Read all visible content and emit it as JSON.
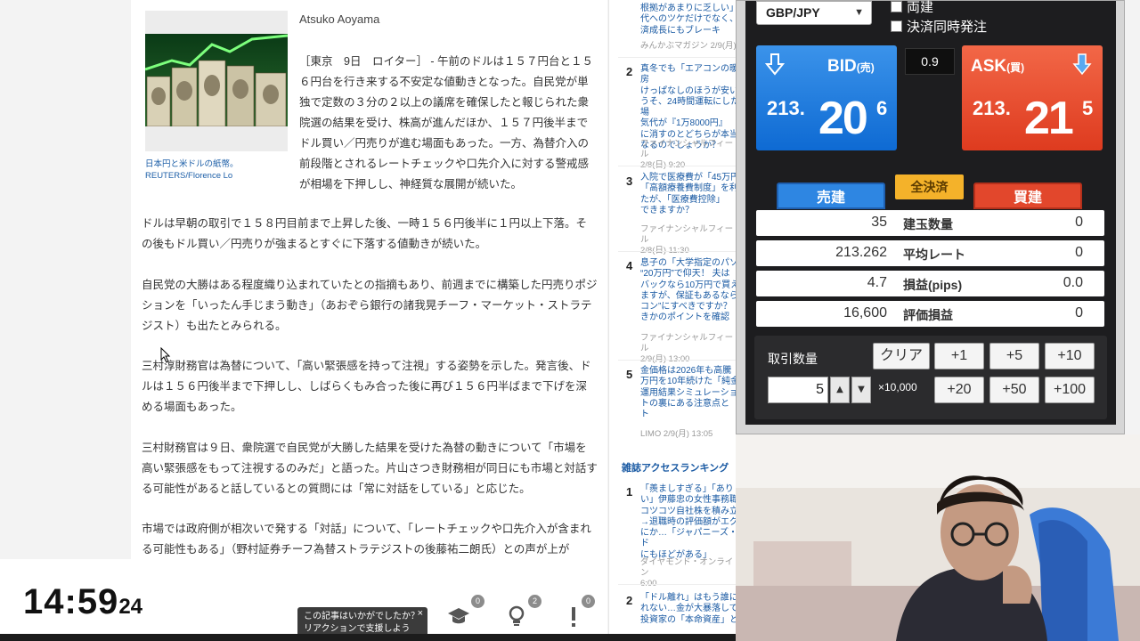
{
  "article": {
    "author": "Atsuko Aoyama",
    "caption": "日本円と米ドルの紙幣。\nREUTERS/Florence Lo",
    "lead": "［東京　9日　ロイター］ - 午前のドルは１５７円台と１５６円台を行き来する不安定な値動きとなった。自民党が単独で定数の３分の２以上の議席を確保したと報じられた衆院選の結果を受け、株高が進んだほか、１５７円後半までドル買い／円売りが進む場面もあった。一方、為替介入の前段階とされるレートチェックや口先介入に対する警戒感が相場を下押しし、神経質な展開が続いた。",
    "paragraphs": [
      "ドルは早朝の取引で１５８円目前まで上昇した後、一時１５６円後半に１円以上下落。その後もドル買い／円売りが強まるとすぐに下落する値動きが続いた。",
      "自民党の大勝はある程度織り込まれていたとの指摘もあり、前週までに構築した円売りポジションを「いったん手じまう動き」（あおぞら銀行の諸我晃チーフ・マーケット・ストラテジスト）も出たとみられる。",
      "三村淳財務官は為替について、「高い緊張感を持って注視」する姿勢を示した。発言後、ドルは１５６円後半まで下押しし、しばらくもみ合った後に再び１５６円半ばまで下げを深める場面もあった。",
      "三村財務官は９日、衆院選で自民党が大勝した結果を受けた為替の動きについて「市場を高い緊張感をもって注視するのみだ」と語った。片山さつき財務相が同日にも市場と対話する可能性があると話しているとの質問には「常に対話をしている」と応じた。",
      "市場では政府側が相次いで発する「対話」について、「レートチェックや口先介入が含まれる可能性もある」（野村証券チーフ為替ストラテジストの後藤祐二朗氏）との声が上が"
    ]
  },
  "sidebar": {
    "top_item": {
      "title": "根拠があまりに乏しい」\n代へのツケだけでなく、\n済成長にもブレーキ",
      "meta": "みんかぶマガジン 2/9(月)"
    },
    "items": [
      {
        "rank": "2",
        "title": "真冬でも「エアコンの暖房\nけっぱなしのほうが安い\nうそ、24時間運転にした場\n気代が『1万8000円』\nに消すのとどちらが本当\nなるのでしょうか？",
        "meta": "ファイナンシャルフィール\n2/8(日) 9:20"
      },
      {
        "rank": "3",
        "title": "入院で医療費が「45万円\n「高額療養費制度」を利\nたが、「医療費控除」\nできますか？",
        "meta": "ファイナンシャルフィール\n2/8(日) 11:30"
      },
      {
        "rank": "4",
        "title": "息子の「大学指定のパソ\n“20万円”で仰天！ 夫は\nバックなら10万円で買え\nますが、保証もあるなら\nコン”にすべきですか？\nきかのポイントを確認",
        "meta": "ファイナンシャルフィール\n2/9(月) 13:00"
      },
      {
        "rank": "5",
        "title": "金価格は2026年も高騰\n万円を10年続けた「純金\n運用結果シミュレーショ\nトの裏にある注意点と\nト",
        "meta": "LIMO 2/9(月) 13:05"
      }
    ],
    "access_heading": "雑誌アクセスランキング",
    "access_items": [
      {
        "rank": "1",
        "title": "「羨ましすぎる」「あり\nい」伊藤忠の女性事務職\nコツコツ自社株を積み立\n→退職時の評価額がエグ\nにか…「ジャパニーズ・ド\nにもほどがある」",
        "meta": "ダイヤモンド・オンライン\n6:00"
      },
      {
        "rank": "2",
        "title": "「ドル離れ」はもう誰に\nれない…金が大暴落して\n投資家の「本命資産」と",
        "meta": ""
      }
    ]
  },
  "trading": {
    "pair": "GBP/JPY",
    "checkbox_hedge": "両建",
    "checkbox_simultaneous": "決済同時発注",
    "spread": "0.9",
    "bid": {
      "label": "BID",
      "sub": "(売)",
      "prefix": "213.",
      "big": "20",
      "pip": "6",
      "color": "#1a78df"
    },
    "ask": {
      "label": "ASK",
      "sub": "(買)",
      "prefix": "213.",
      "big": "21",
      "pip": "5",
      "color": "#e64a2c"
    },
    "close_all": "全決済",
    "sell_tab": "売建",
    "buy_tab": "買建",
    "stats": [
      {
        "left": "35",
        "label": "建玉数量",
        "right": "0"
      },
      {
        "left": "213.262",
        "label": "平均レート",
        "right": "0"
      },
      {
        "left": "4.7",
        "label": "損益(pips)",
        "right": "0.0"
      },
      {
        "left": "16,600",
        "label": "評価損益",
        "right": "0"
      }
    ],
    "qty_label": "取引数量",
    "qty_value": "5",
    "unit": "×10,000",
    "clear": "クリア",
    "buttons_row1": [
      "+1",
      "+5",
      "+10"
    ],
    "buttons_row2": [
      "+20",
      "+50",
      "+100"
    ]
  },
  "clock": {
    "time": "14:59",
    "seconds": "24"
  },
  "feedback": {
    "text": "この記事はいかがでしたか？\nリアクションで支援しよう",
    "close": "×"
  },
  "reactions": [
    {
      "icon": "graduation-cap-icon",
      "count": "0"
    },
    {
      "icon": "lightbulb-icon",
      "count": "2"
    },
    {
      "icon": "exclamation-icon",
      "count": "0"
    }
  ]
}
